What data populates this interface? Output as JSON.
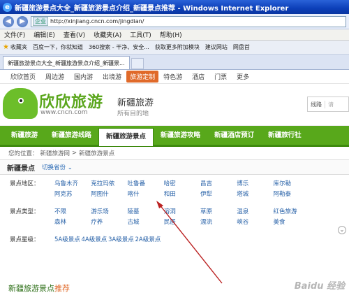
{
  "window": {
    "title": "新疆旅游景点大全_新疆旅游景点介绍_新疆景点推荐 - Windows Internet Explorer"
  },
  "address": {
    "tag": "企业",
    "url": "http://xinjiang.cncn.com/jingdian/"
  },
  "menu": [
    "文件(F)",
    "编辑(E)",
    "查看(V)",
    "收藏夹(A)",
    "工具(T)",
    "帮助(H)"
  ],
  "favorites": {
    "label": "收藏夹",
    "items": [
      "百度一下，你就知道",
      "360搜索 - 干净、安全...",
      "获取更多附加模块",
      "建议网站",
      "网盘首"
    ]
  },
  "tab": {
    "title": "新疆旅游景点大全_新疆旅游景点介绍_新疆景..."
  },
  "sitenav": {
    "items": [
      "欣欣首页",
      "周边游",
      "国内游",
      "出境游",
      "旅游定制",
      "特色游",
      "酒店",
      "门票",
      "更多"
    ],
    "highlight_index": 4
  },
  "header": {
    "brand": "欣欣旅游",
    "brand_url": "www.cncn.com",
    "title": "新疆旅游",
    "subtitle": "所有目的地",
    "search_select": "线路",
    "search_placeholder": "请"
  },
  "greennav": {
    "items": [
      "新疆旅游",
      "新疆旅游线路",
      "新疆旅游景点",
      "新疆旅游攻略",
      "新疆酒店预订",
      "新疆旅行社"
    ],
    "active_index": 2
  },
  "breadcrumb": [
    "您的位置：",
    "新疆旅游网",
    ">",
    "新疆旅游景点"
  ],
  "section": {
    "title": "新疆景点",
    "switch": "切换省份"
  },
  "filters": {
    "areas_label": "景点地区：",
    "areas_row1": [
      "乌鲁木齐",
      "克拉玛依",
      "吐鲁番",
      "哈密",
      "昌吉",
      "博乐",
      "库尔勒"
    ],
    "areas_row2": [
      "阿克苏",
      "阿图什",
      "喀什",
      "和田",
      "伊犁",
      "塔城",
      "阿勒泰"
    ],
    "types_label": "景点类型：",
    "types_row1": [
      "不限",
      "游乐场",
      "陵墓",
      "溶洞",
      "草原",
      "温泉",
      "红色旅游"
    ],
    "types_row2": [
      "森林",
      "疗养",
      "古城",
      "民居",
      "漂流",
      "峡谷",
      "美食"
    ],
    "stars_label": "景点星级：",
    "stars": [
      "5A级景点",
      "4A级景点",
      "3A级景点",
      "2A级景点"
    ]
  },
  "bottom": {
    "title": "新疆旅游景点",
    "hot": "推荐"
  },
  "watermark": "Baidu 经验"
}
